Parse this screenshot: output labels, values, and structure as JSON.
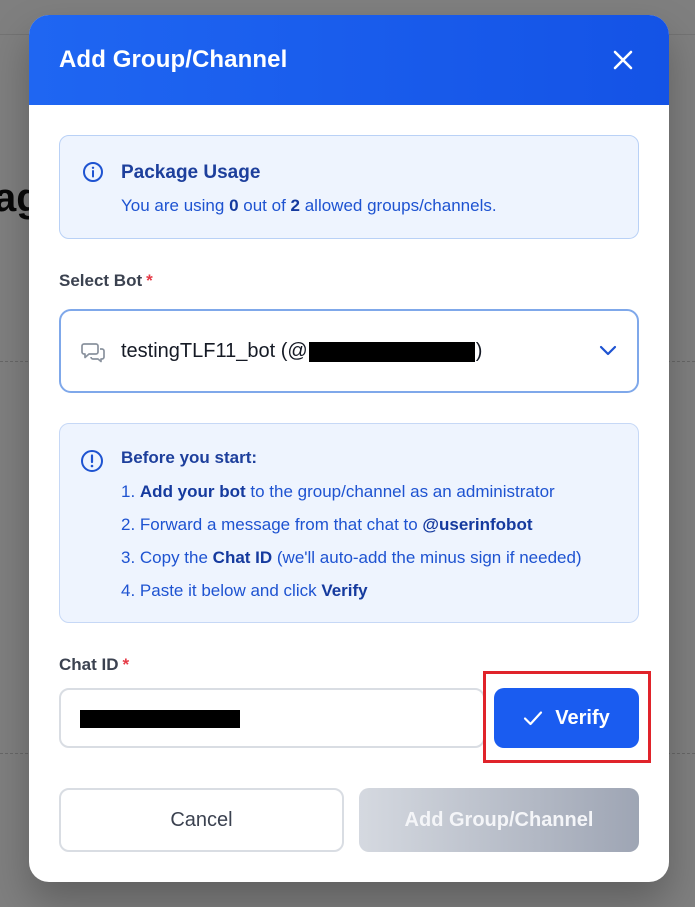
{
  "modal": {
    "title": "Add Group/Channel"
  },
  "background": {
    "heading_fragment": "ag"
  },
  "usage": {
    "title": "Package Usage",
    "prefix": "You are using ",
    "used": "0",
    "middle": " out of ",
    "allowed": "2",
    "suffix": " allowed groups/channels."
  },
  "select_bot": {
    "label": "Select Bot",
    "required_mark": "*",
    "value_prefix": "testingTLF11_bot (@",
    "value_suffix": ")"
  },
  "before_start": {
    "title": "Before you start:",
    "steps": [
      {
        "pre": "1. ",
        "bold": "Add your bot",
        "post": " to the group/channel as an administrator"
      },
      {
        "pre": "2. Forward a message from that chat to ",
        "bold": "@userinfobot",
        "post": ""
      },
      {
        "pre": "3. Copy the ",
        "bold": "Chat ID",
        "post": " (we'll auto-add the minus sign if needed)"
      },
      {
        "pre": "4. Paste it below and click ",
        "bold": "Verify",
        "post": ""
      }
    ]
  },
  "chat_id": {
    "label": "Chat ID",
    "required_mark": "*"
  },
  "buttons": {
    "verify": "Verify",
    "cancel": "Cancel",
    "add": "Add Group/Channel"
  },
  "colors": {
    "accent": "#1a5cf0",
    "highlight": "#e0232a",
    "required": "#e53945"
  },
  "icons": {
    "close": "close-icon",
    "info": "info-icon",
    "chat": "chat-bubbles-icon",
    "chevron": "chevron-down-icon",
    "alert": "alert-circle-icon",
    "check": "check-icon"
  }
}
